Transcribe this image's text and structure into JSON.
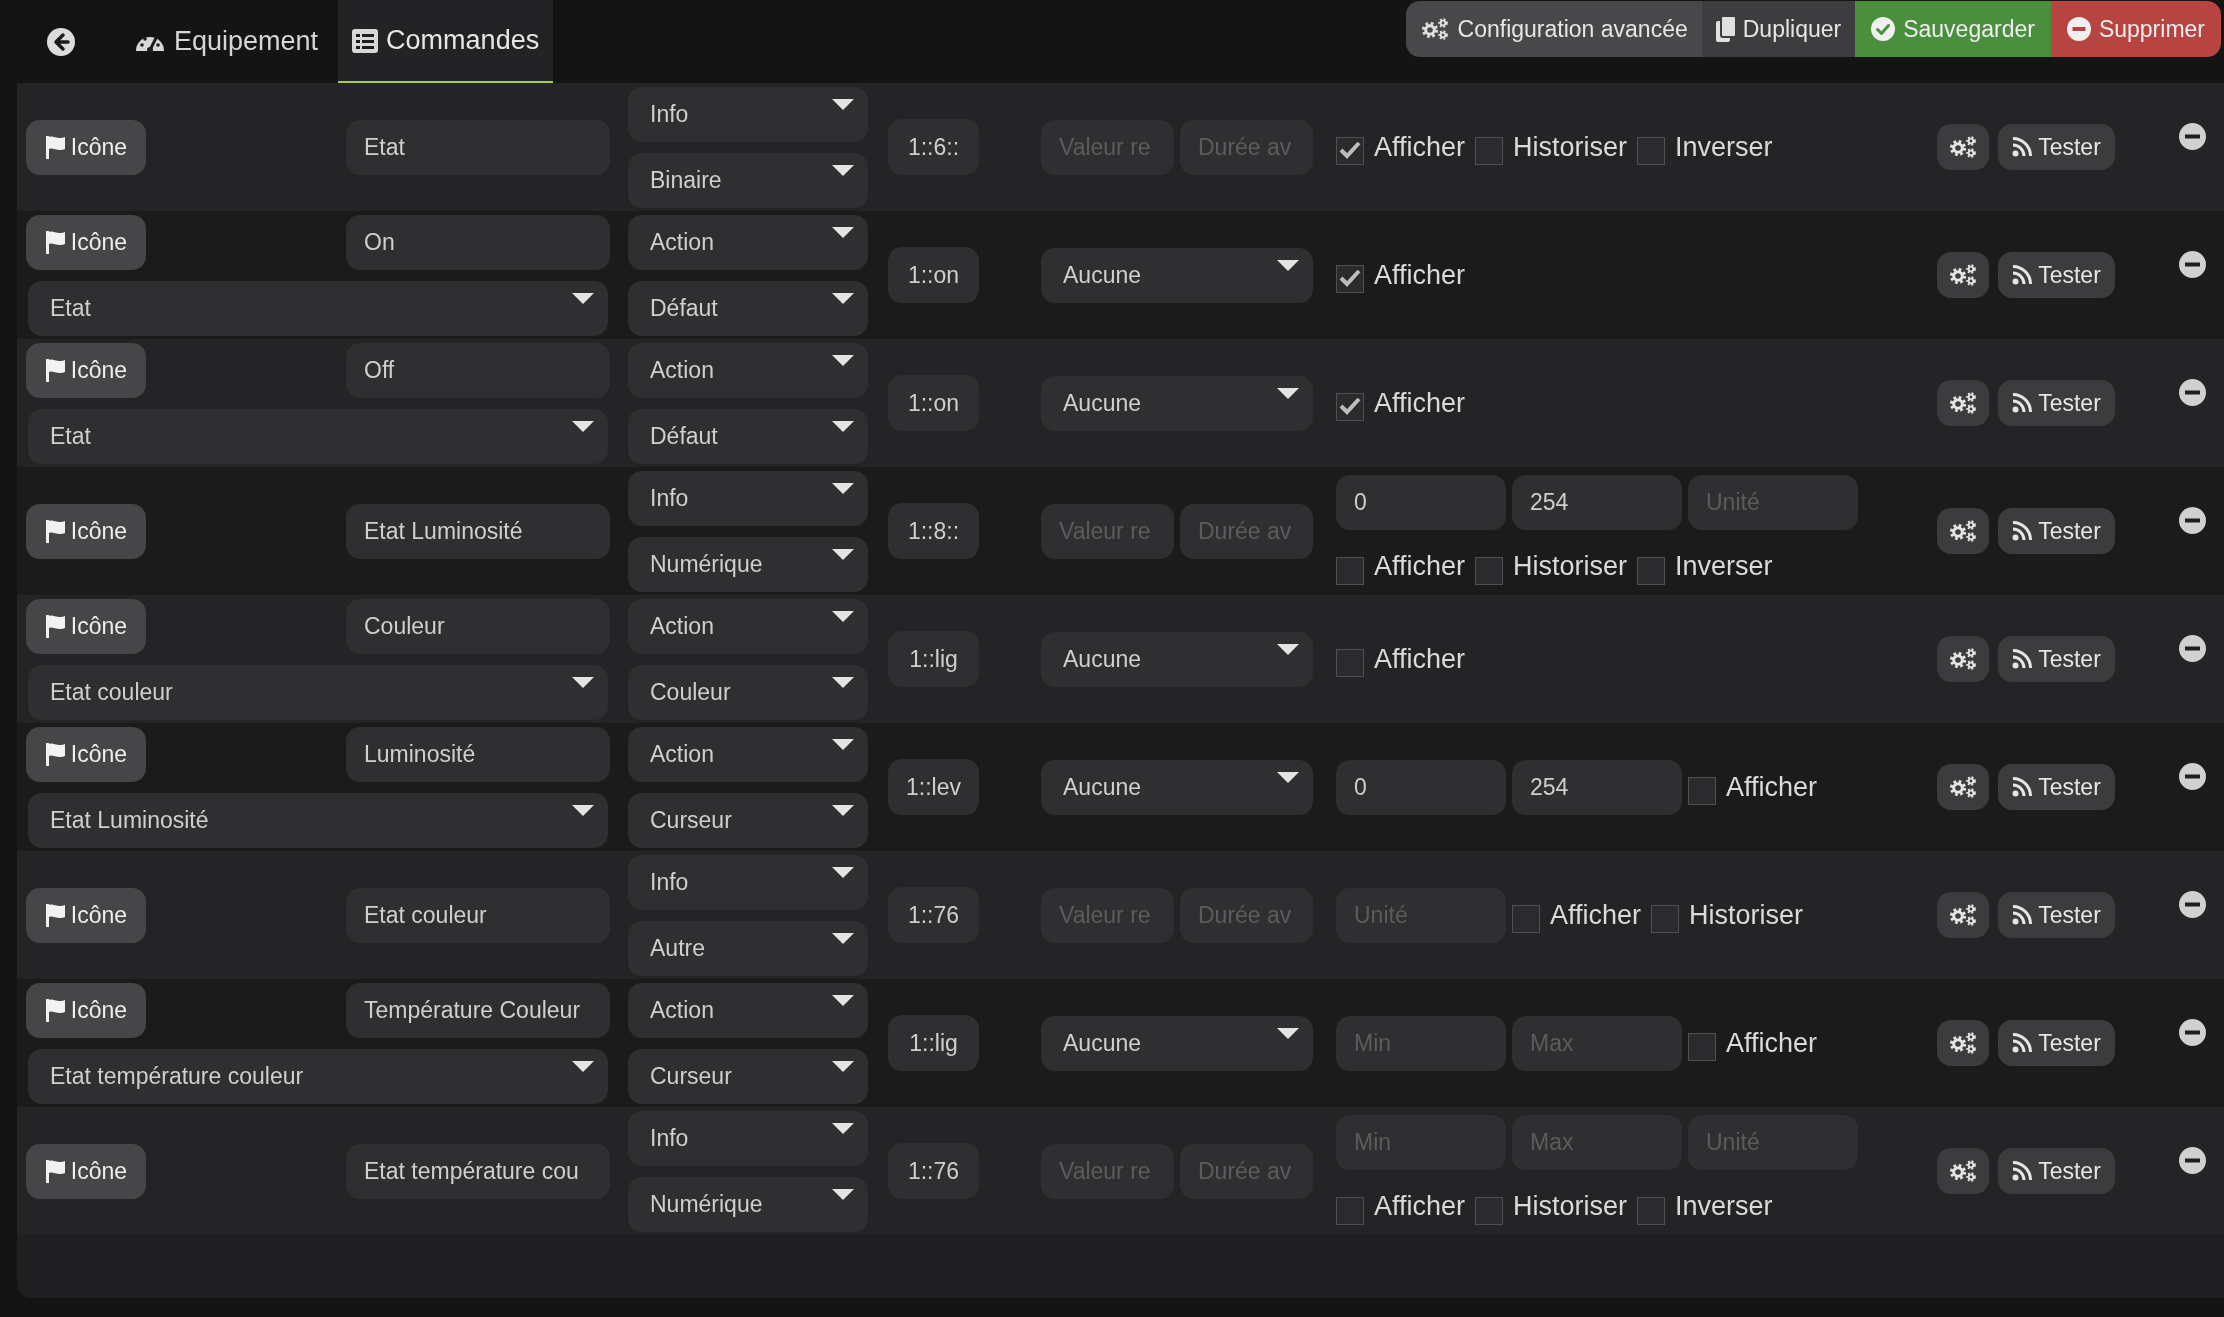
{
  "top_bar": {
    "tabs": [
      {
        "label": "Equipement",
        "kind": "gauge",
        "selected": false
      },
      {
        "label": "Commandes",
        "kind": "list",
        "selected": true
      }
    ],
    "actions": [
      {
        "label": "Configuration avancée",
        "kind": "config"
      },
      {
        "label": "Dupliquer",
        "kind": "copy"
      },
      {
        "label": "Sauvegarder",
        "kind": "save"
      },
      {
        "label": "Supprimer",
        "kind": "delete"
      }
    ]
  },
  "commands": [
    {
      "kind": "info",
      "icon_button": "Icône",
      "name": "Etat",
      "type": "Info",
      "subtype": "Binaire",
      "logical_id": "1::6::",
      "settings": [
        {
          "kind": "input",
          "placeholder": "Valeur re"
        },
        {
          "kind": "input",
          "placeholder": "Durée av"
        }
      ],
      "checkboxes": [
        {
          "label": "Afficher",
          "checked": true
        },
        {
          "label": "Historiser",
          "checked": false
        },
        {
          "label": "Inverser",
          "checked": false
        }
      ],
      "test_button": "Tester"
    },
    {
      "kind": "action",
      "icon_button": "Icône",
      "name": "On",
      "linked_info": "Etat",
      "type": "Action",
      "subtype": "Défaut",
      "logical_id": "1::on",
      "settings": [
        {
          "kind": "select",
          "value": "Aucune"
        }
      ],
      "checkboxes": [
        {
          "label": "Afficher",
          "checked": true
        }
      ],
      "test_button": "Tester"
    },
    {
      "kind": "action",
      "icon_button": "Icône",
      "name": "Off",
      "linked_info": "Etat",
      "type": "Action",
      "subtype": "Défaut",
      "logical_id": "1::on",
      "settings": [
        {
          "kind": "select",
          "value": "Aucune"
        }
      ],
      "checkboxes": [
        {
          "label": "Afficher",
          "checked": true
        }
      ],
      "test_button": "Tester"
    },
    {
      "kind": "info",
      "icon_button": "Icône",
      "name": "Etat Luminosité",
      "type": "Info",
      "subtype": "Numérique",
      "logical_id": "1::8::",
      "settings": [
        {
          "kind": "input",
          "placeholder": "Valeur re"
        },
        {
          "kind": "input",
          "placeholder": "Durée av"
        }
      ],
      "params": [
        {
          "value": "0"
        },
        {
          "value": "254"
        },
        {
          "placeholder": "Unité"
        }
      ],
      "checkboxes": [
        {
          "label": "Afficher",
          "checked": false
        },
        {
          "label": "Historiser",
          "checked": false
        },
        {
          "label": "Inverser",
          "checked": false
        }
      ],
      "test_button": "Tester"
    },
    {
      "kind": "action",
      "icon_button": "Icône",
      "name": "Couleur",
      "linked_info": "Etat couleur",
      "type": "Action",
      "subtype": "Couleur",
      "logical_id": "1::lig",
      "settings": [
        {
          "kind": "select",
          "value": "Aucune"
        }
      ],
      "checkboxes": [
        {
          "label": "Afficher",
          "checked": false
        }
      ],
      "test_button": "Tester"
    },
    {
      "kind": "action",
      "icon_button": "Icône",
      "name": "Luminosité",
      "linked_info": "Etat Luminosité",
      "type": "Action",
      "subtype": "Curseur",
      "logical_id": "1::lev",
      "settings": [
        {
          "kind": "select",
          "value": "Aucune"
        }
      ],
      "params": [
        {
          "value": "0"
        },
        {
          "value": "254"
        }
      ],
      "checkboxes": [
        {
          "label": "Afficher",
          "checked": false
        }
      ],
      "test_button": "Tester"
    },
    {
      "kind": "info",
      "icon_button": "Icône",
      "name": "Etat couleur",
      "type": "Info",
      "subtype": "Autre",
      "logical_id": "1::76",
      "settings": [
        {
          "kind": "input",
          "placeholder": "Valeur re"
        },
        {
          "kind": "input",
          "placeholder": "Durée av"
        }
      ],
      "params": [
        {
          "placeholder": "Unité"
        }
      ],
      "checkboxes": [
        {
          "label": "Afficher",
          "checked": false
        },
        {
          "label": "Historiser",
          "checked": false
        }
      ],
      "test_button": "Tester"
    },
    {
      "kind": "action",
      "icon_button": "Icône",
      "name": "Température Couleur",
      "linked_info": "Etat température couleur",
      "type": "Action",
      "subtype": "Curseur",
      "logical_id": "1::lig",
      "settings": [
        {
          "kind": "select",
          "value": "Aucune"
        }
      ],
      "params": [
        {
          "placeholder": "Min"
        },
        {
          "placeholder": "Max"
        }
      ],
      "checkboxes": [
        {
          "label": "Afficher",
          "checked": false
        }
      ],
      "test_button": "Tester"
    },
    {
      "kind": "info",
      "icon_button": "Icône",
      "name": "Etat température cou",
      "type": "Info",
      "subtype": "Numérique",
      "logical_id": "1::76",
      "settings": [
        {
          "kind": "input",
          "placeholder": "Valeur re"
        },
        {
          "kind": "input",
          "placeholder": "Durée av"
        }
      ],
      "params": [
        {
          "placeholder": "Min"
        },
        {
          "placeholder": "Max"
        },
        {
          "placeholder": "Unité"
        }
      ],
      "checkboxes": [
        {
          "label": "Afficher",
          "checked": false
        },
        {
          "label": "Historiser",
          "checked": false
        },
        {
          "label": "Inverser",
          "checked": false
        }
      ],
      "test_button": "Tester"
    }
  ]
}
